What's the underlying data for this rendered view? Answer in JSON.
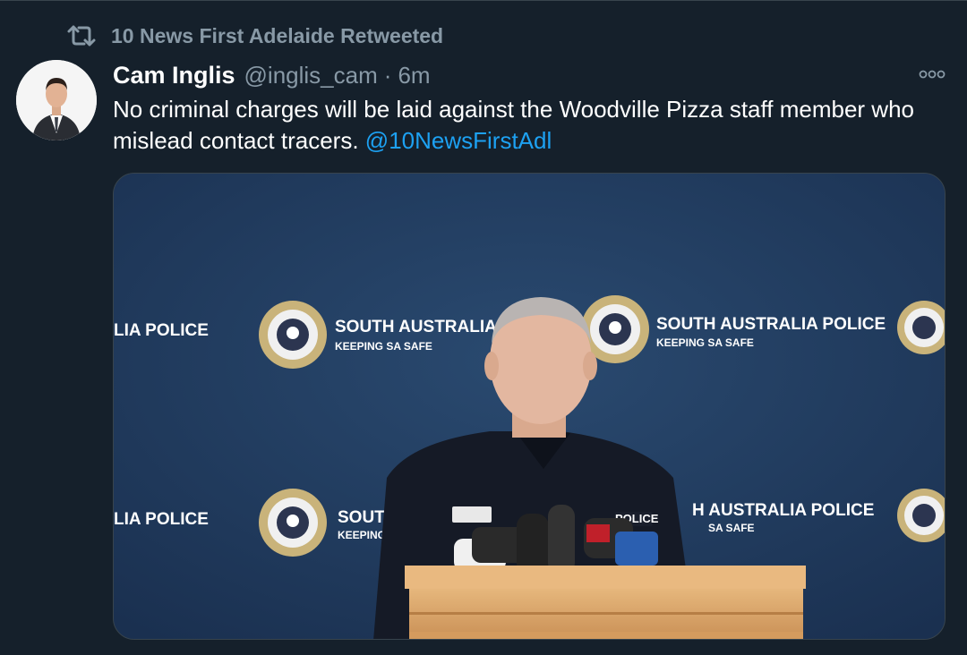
{
  "social_context": {
    "icon": "retweet-icon",
    "text": "10 News First Adelaide Retweeted"
  },
  "tweet": {
    "author_name": "Cam Inglis",
    "handle": "@inglis_cam",
    "separator": "·",
    "time": "6m",
    "text_before": "No criminal charges will be laid against the Woodville Pizza staff member who mislead contact tracers.",
    "mention": "@10NewsFirstAdl",
    "more_icon": "more-options-icon"
  },
  "media": {
    "backdrop_brand": "SOUTH AUSTRALIA POLICE",
    "backdrop_brand_partial_left": "LIA POLICE",
    "backdrop_brand_cut": "SOUTH AUSTRALIA POLIC",
    "backdrop_brand_lower_left": "LIA POLICE",
    "backdrop_brand_lower_cut": "SOUTH",
    "backdrop_brand_lower_right": "H AUSTRALIA POLICE",
    "backdrop_tagline": "KEEPING SA SAFE",
    "backdrop_tagline_cut": "KEEPING",
    "backdrop_tagline_lower_right": "SA SAFE",
    "shoulder_label": "POLICE"
  },
  "colors": {
    "background": "#15202b",
    "text_secondary": "#8899a6",
    "link": "#1da1f2",
    "backdrop": "#1f3656",
    "lectern": "#dca66b"
  }
}
